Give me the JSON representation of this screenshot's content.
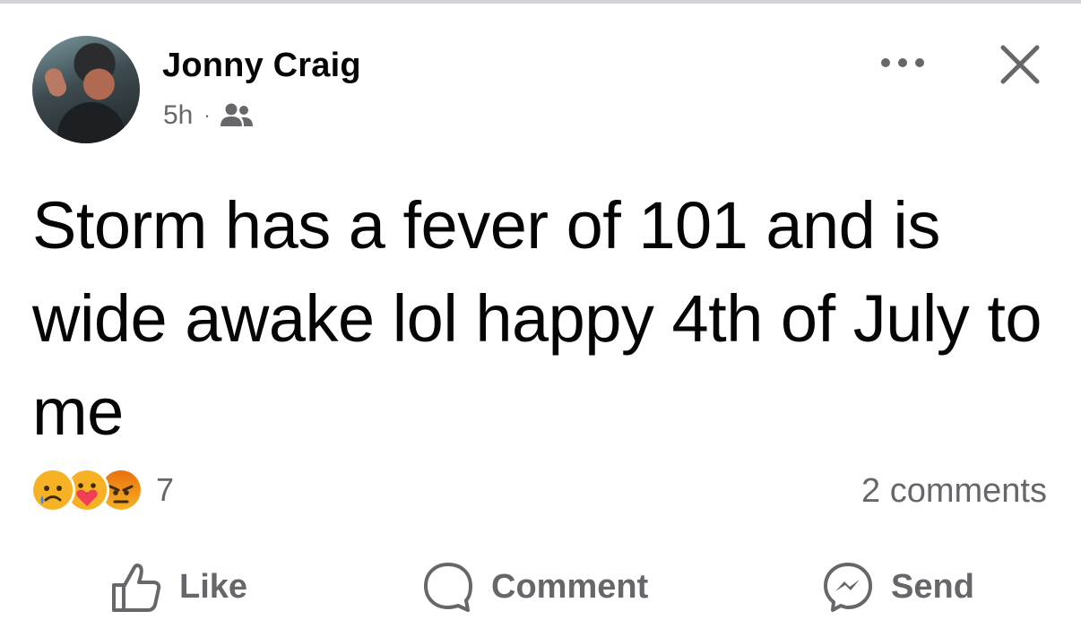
{
  "post": {
    "author": "Jonny Craig",
    "time": "5h",
    "separator": "·",
    "audience_icon": "friends-icon",
    "text": "Storm has a fever of 101 and is wide awake lol happy 4th of July to me"
  },
  "header_icons": {
    "more": "more-dots-icon",
    "close": "close-icon"
  },
  "reactions": {
    "icons": [
      "sad-reaction",
      "care-reaction",
      "angry-reaction"
    ],
    "count": "7"
  },
  "comments": {
    "label": "2 comments"
  },
  "actions": {
    "like": "Like",
    "comment": "Comment",
    "send": "Send"
  },
  "colors": {
    "text": "#050505",
    "secondary": "#65676b",
    "sad": "#f7b125",
    "angry": "#e9710f"
  }
}
